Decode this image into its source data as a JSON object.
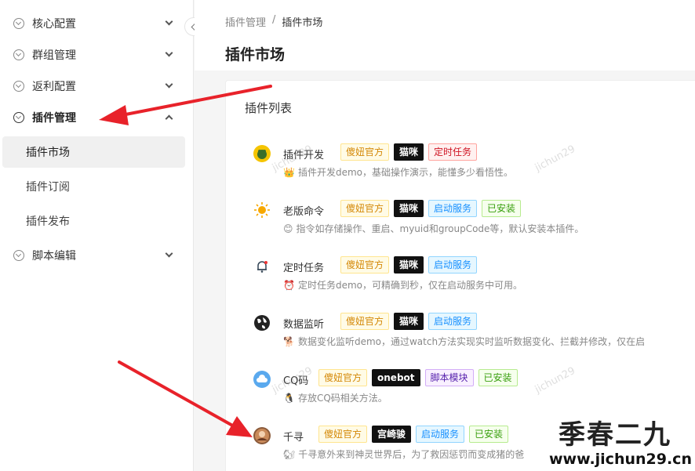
{
  "sidebar": {
    "menus": [
      {
        "label": "核心配置",
        "open": false
      },
      {
        "label": "群组管理",
        "open": false
      },
      {
        "label": "返利配置",
        "open": false
      },
      {
        "label": "插件管理",
        "open": true
      },
      {
        "label": "脚本编辑",
        "open": false
      }
    ],
    "submenu": [
      "插件市场",
      "插件订阅",
      "插件发布"
    ],
    "active_sub": "插件市场"
  },
  "breadcrumb": {
    "parent": "插件管理",
    "separator": "/",
    "current": "插件市场"
  },
  "page_title": "插件市场",
  "card_title": "插件列表",
  "plugins": [
    {
      "name": "插件开发",
      "icon": "frog-icon",
      "tags": [
        {
          "label": "傻妞官方",
          "color": "gold"
        },
        {
          "label": "猫咪",
          "color": "black"
        },
        {
          "label": "定时任务",
          "color": "red"
        }
      ],
      "desc_emoji": "👑",
      "desc": "插件开发demo，基础操作演示，能懂多少看悟性。"
    },
    {
      "name": "老版命令",
      "icon": "sun-icon",
      "tags": [
        {
          "label": "傻妞官方",
          "color": "gold"
        },
        {
          "label": "猫咪",
          "color": "black"
        },
        {
          "label": "启动服务",
          "color": "blue"
        },
        {
          "label": "已安装",
          "color": "green"
        }
      ],
      "desc_emoji": "😊",
      "desc": "指令如存储操作、重启、myuid和groupCode等，默认安装本插件。"
    },
    {
      "name": "定时任务",
      "icon": "bell-icon",
      "tags": [
        {
          "label": "傻妞官方",
          "color": "gold"
        },
        {
          "label": "猫咪",
          "color": "black"
        },
        {
          "label": "启动服务",
          "color": "blue"
        }
      ],
      "desc_emoji": "⏰",
      "desc": "定时任务demo，可精确到秒，仅在启动服务中可用。"
    },
    {
      "name": "数据监听",
      "icon": "globe-icon",
      "tags": [
        {
          "label": "傻妞官方",
          "color": "gold"
        },
        {
          "label": "猫咪",
          "color": "black"
        },
        {
          "label": "启动服务",
          "color": "blue"
        }
      ],
      "desc_emoji": "🐕",
      "desc": "数据变化监听demo，通过watch方法实现实时监听数据变化、拦截并修改，仅在启"
    },
    {
      "name": "CQ码",
      "icon": "cloud-icon",
      "tags": [
        {
          "label": "傻妞官方",
          "color": "gold"
        },
        {
          "label": "onebot",
          "color": "black"
        },
        {
          "label": "脚本模块",
          "color": "purple"
        },
        {
          "label": "已安装",
          "color": "green"
        }
      ],
      "desc_emoji": "🐧",
      "desc": "存放CQ码相关方法。"
    },
    {
      "name": "千寻",
      "icon": "avatar-icon",
      "tags": [
        {
          "label": "傻妞官方",
          "color": "gold"
        },
        {
          "label": "宫崎骏",
          "color": "black"
        },
        {
          "label": "启动服务",
          "color": "blue"
        },
        {
          "label": "已安装",
          "color": "green"
        }
      ],
      "desc_emoji": "🐿",
      "desc": "千寻意外来到神灵世界后，为了救因惩罚而变成猪的爸"
    }
  ],
  "watermarks": [
    "jichun29",
    "jichun29",
    "jichun29",
    "jichun29"
  ],
  "logo": {
    "big": "季春二九",
    "url": "www.jichun29.cn"
  },
  "colors": {
    "arrow": "#e8222a"
  }
}
